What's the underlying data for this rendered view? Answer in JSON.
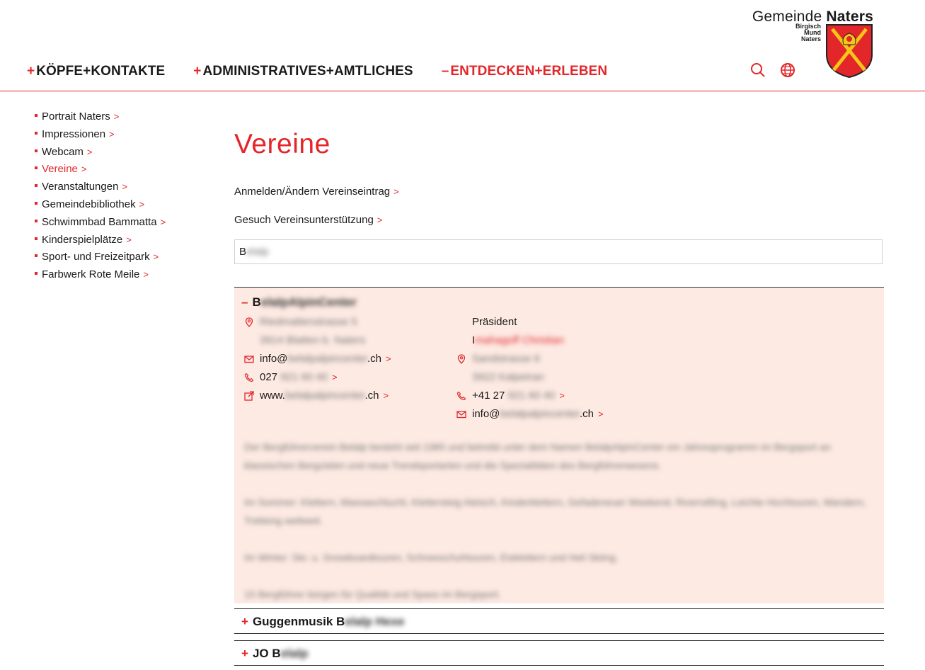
{
  "brand": {
    "name_regular": "Gemeinde",
    "name_bold": "Naters",
    "sub_lines": [
      "Birgisch",
      "Mund",
      "Naters"
    ]
  },
  "nav": [
    {
      "sign": "+",
      "label": "KÖPFE+KONTAKTE",
      "active": false
    },
    {
      "sign": "+",
      "label": "ADMINISTRATIVES+AMTLICHES",
      "active": false
    },
    {
      "sign": "–",
      "label": "ENTDECKEN+ERLEBEN",
      "active": true
    }
  ],
  "header_icons": [
    "search-icon",
    "globe-icon"
  ],
  "sidebar": [
    {
      "label": "Portrait Naters",
      "active": false
    },
    {
      "label": "Impressionen",
      "active": false
    },
    {
      "label": "Webcam",
      "active": false
    },
    {
      "label": "Vereine",
      "active": true
    },
    {
      "label": "Veranstaltungen",
      "active": false
    },
    {
      "label": "Gemeindebibliothek",
      "active": false
    },
    {
      "label": "Schwimmbad Bammatta",
      "active": false
    },
    {
      "label": "Kinderspielplätze",
      "active": false
    },
    {
      "label": "Sport- und Freizeitpark",
      "active": false
    },
    {
      "label": "Farbwerk Rote Meile",
      "active": false
    }
  ],
  "arrow": ">",
  "page": {
    "title": "Vereine",
    "links": [
      "Anmelden/Ändern Vereinseintrag",
      "Gesuch Vereinsunterstützung"
    ],
    "search": {
      "typed": "B",
      "blurred": "elalp"
    }
  },
  "entries": {
    "open": {
      "sign": "–",
      "title_visible": "B",
      "title_blurred": "elalpAlpinCenter",
      "address_blurred": [
        "Riedmattenstrasse 5",
        "3914 Blatten b. Naters"
      ],
      "email_prefix": "info@",
      "email_blurred": "belalpalpincenter",
      "email_suffix": ".ch",
      "phone_prefix": "027",
      "phone_blurred": " 921 60 40",
      "web_prefix": "www.",
      "web_blurred": "belalpalpincenter",
      "web_suffix": ".ch",
      "president_label": "Präsident",
      "president_visible": "I",
      "president_blurred": "mahagoff Christian",
      "pres_address_blurred": [
        "Sandstrasse 6",
        "3922 Kalpetran"
      ],
      "pres_phone_prefix": "+41 27",
      "pres_phone_blurred": " 921 60 40",
      "pres_email_prefix": "info@",
      "pres_email_blurred": "belalpalpincenter",
      "pres_email_suffix": ".ch",
      "description_blurred": [
        "Der Bergführerverein Belalp besteht seit 1985 und betreibt unter dem Namen BelalpAlpinCenter ein Jahresprogramm im Bergsport an klassischen Bergzielen und neue Trendsportarten und die Spezialitäten des Bergführerwesens.",
        "Im Sommer: Klettern, Massaschlucht, Klettersteig Aletsch, Kinderklettern, Gefadeneuer Weekend, Riverrafting, Leichte Hochtouren, Wandern, Trekking weltweit.",
        "Im Winter: Ski- u. Snowboardtouren, Schneeschuhtouren, Eisklettern und Heli Skiing.",
        "15 Bergführer bürgen für Qualität und Spass im Bergsport."
      ]
    },
    "closed": [
      {
        "sign": "+",
        "title_visible": "Guggenmusik B",
        "title_blurred": "elalp Hexe"
      },
      {
        "sign": "+",
        "title_visible": "JO B",
        "title_blurred": "elalp"
      }
    ]
  }
}
